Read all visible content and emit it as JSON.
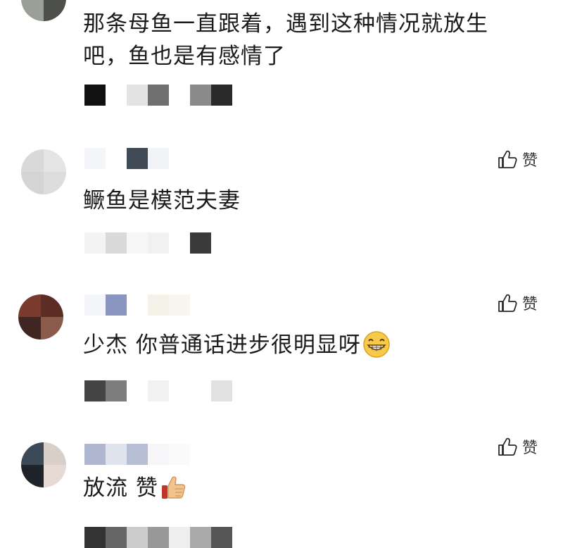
{
  "comments": [
    {
      "text_line1": "那条母鱼一直跟着，遇到这种情况就放生",
      "text_line2": "吧，鱼也是有感情了",
      "avatar_colors": [
        "#6b6f6a",
        "#3d403c",
        "#9aa097",
        "#4c4f4a"
      ],
      "meta_colors": [
        "#111111",
        "#ffffff",
        "#e3e3e3",
        "#707070",
        "#ffffff",
        "#8a8a8a",
        "#2a2a2a"
      ]
    },
    {
      "text": "鳜鱼是模范夫妻",
      "like_label": "赞",
      "avatar_colors": [
        "#d9d9d9",
        "#e4e4e4",
        "#d4d4d4",
        "#dddddd"
      ],
      "name_colors": [
        "#f3f5f8",
        "#ffffff",
        "#3f4a55",
        "#f1f3f6"
      ],
      "meta_colors": [
        "#f4f4f4",
        "#dadada",
        "#f7f7f7",
        "#f1f1f1",
        "#ffffff",
        "#3a3a3a"
      ]
    },
    {
      "text": "少杰 你普通话进步很明显呀",
      "like_label": "赞",
      "avatar_colors": [
        "#7a3b2d",
        "#5b2d24",
        "#3f2622",
        "#8a5a4a"
      ],
      "name_colors": [
        "#f3f5f9",
        "#8a96c0",
        "#ffffff",
        "#f4f2e8",
        "#f7f5ee"
      ],
      "meta_colors": [
        "#444444",
        "#7d7d7d",
        "#ffffff",
        "#f2f2f2",
        "#ffffff",
        "#ffffff",
        "#e1e1e1"
      ],
      "emoji_icon": "grinning-face-icon"
    },
    {
      "text": "放流 赞",
      "like_label": "赞",
      "avatar_colors": [
        "#3c4956",
        "#d8cfc9",
        "#1e2329",
        "#e7dad4"
      ],
      "name_colors": [
        "#aeb6d0",
        "#dfe3ee",
        "#b7bfd6",
        "#f6f6f8",
        "#fafafa"
      ],
      "meta_colors": [
        "#333333",
        "#666666",
        "#cccccc",
        "#999999",
        "#eeeeee",
        "#aaaaaa",
        "#555555"
      ],
      "emoji_icon": "thumbs-up-icon"
    }
  ],
  "colors": {
    "text": "#1b1b1b",
    "like_icon": "#2a2a2a",
    "emoji_face": "#f7c948"
  }
}
